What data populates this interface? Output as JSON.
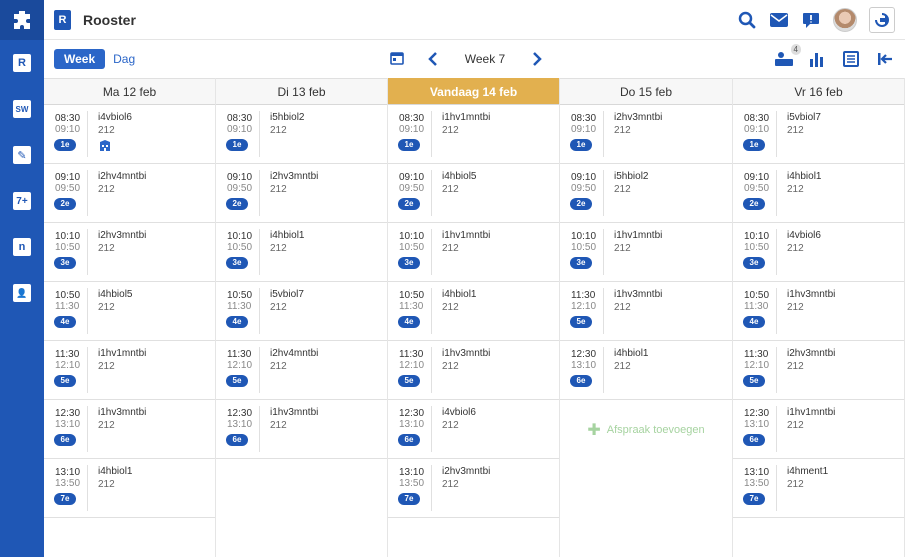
{
  "header": {
    "app_icon_letter": "R",
    "title": "Rooster"
  },
  "sidebar": {
    "items": [
      {
        "name": "rooster",
        "glyph": "R"
      },
      {
        "name": "sw",
        "glyph": "SW"
      },
      {
        "name": "huiswerk",
        "glyph": "✎"
      },
      {
        "name": "cijfers",
        "glyph": "7+"
      },
      {
        "name": "nieuws",
        "glyph": "n"
      },
      {
        "name": "leerlingen",
        "glyph": "👤"
      }
    ]
  },
  "toolbar": {
    "week_label": "Week",
    "day_label": "Dag",
    "current_week": "Week 7",
    "notifications_badge": "4"
  },
  "colors": {
    "brand": "#1f57b5",
    "today": "#e2b04f",
    "add": "#a6d3a0"
  },
  "days": [
    {
      "label": "Ma 12 feb",
      "today": false,
      "lessons": [
        {
          "start": "08:30",
          "end": "09:10",
          "hour": "1e",
          "group": "i4vbiol6",
          "room": "212",
          "icon": "building-icon"
        },
        {
          "start": "09:10",
          "end": "09:50",
          "hour": "2e",
          "group": "i2hv4mntbi",
          "room": "212"
        },
        {
          "start": "10:10",
          "end": "10:50",
          "hour": "3e",
          "group": "i2hv3mntbi",
          "room": "212"
        },
        {
          "start": "10:50",
          "end": "11:30",
          "hour": "4e",
          "group": "i4hbiol5",
          "room": "212"
        },
        {
          "start": "11:30",
          "end": "12:10",
          "hour": "5e",
          "group": "i1hv1mntbi",
          "room": "212"
        },
        {
          "start": "12:30",
          "end": "13:10",
          "hour": "6e",
          "group": "i1hv3mntbi",
          "room": "212"
        },
        {
          "start": "13:10",
          "end": "13:50",
          "hour": "7e",
          "group": "i4hbiol1",
          "room": "212"
        }
      ]
    },
    {
      "label": "Di 13 feb",
      "today": false,
      "lessons": [
        {
          "start": "08:30",
          "end": "09:10",
          "hour": "1e",
          "group": "i5hbiol2",
          "room": "212"
        },
        {
          "start": "09:10",
          "end": "09:50",
          "hour": "2e",
          "group": "i2hv3mntbi",
          "room": "212"
        },
        {
          "start": "10:10",
          "end": "10:50",
          "hour": "3e",
          "group": "i4hbiol1",
          "room": "212"
        },
        {
          "start": "10:50",
          "end": "11:30",
          "hour": "4e",
          "group": "i5vbiol7",
          "room": "212"
        },
        {
          "start": "11:30",
          "end": "12:10",
          "hour": "5e",
          "group": "i2hv4mntbi",
          "room": "212"
        },
        {
          "start": "12:30",
          "end": "13:10",
          "hour": "6e",
          "group": "i1hv3mntbi",
          "room": "212"
        }
      ]
    },
    {
      "label": "Vandaag 14 feb",
      "today": true,
      "lessons": [
        {
          "start": "08:30",
          "end": "09:10",
          "hour": "1e",
          "group": "i1hv1mntbi",
          "room": "212"
        },
        {
          "start": "09:10",
          "end": "09:50",
          "hour": "2e",
          "group": "i4hbiol5",
          "room": "212"
        },
        {
          "start": "10:10",
          "end": "10:50",
          "hour": "3e",
          "group": "i1hv1mntbi",
          "room": "212"
        },
        {
          "start": "10:50",
          "end": "11:30",
          "hour": "4e",
          "group": "i4hbiol1",
          "room": "212"
        },
        {
          "start": "11:30",
          "end": "12:10",
          "hour": "5e",
          "group": "i1hv3mntbi",
          "room": "212"
        },
        {
          "start": "12:30",
          "end": "13:10",
          "hour": "6e",
          "group": "i4vbiol6",
          "room": "212"
        },
        {
          "start": "13:10",
          "end": "13:50",
          "hour": "7e",
          "group": "i2hv3mntbi",
          "room": "212"
        }
      ]
    },
    {
      "label": "Do 15 feb",
      "today": false,
      "lessons": [
        {
          "start": "08:30",
          "end": "09:10",
          "hour": "1e",
          "group": "i2hv3mntbi",
          "room": "212"
        },
        {
          "start": "09:10",
          "end": "09:50",
          "hour": "2e",
          "group": "i5hbiol2",
          "room": "212"
        },
        {
          "start": "10:10",
          "end": "10:50",
          "hour": "3e",
          "group": "i1hv1mntbi",
          "room": "212"
        },
        {
          "start": "11:30",
          "end": "12:10",
          "hour": "5e",
          "group": "i1hv3mntbi",
          "room": "212"
        },
        {
          "start": "12:30",
          "end": "13:10",
          "hour": "6e",
          "group": "i4hbiol1",
          "room": "212"
        }
      ],
      "add_label": "Afspraak toevoegen"
    },
    {
      "label": "Vr 16 feb",
      "today": false,
      "lessons": [
        {
          "start": "08:30",
          "end": "09:10",
          "hour": "1e",
          "group": "i5vbiol7",
          "room": "212"
        },
        {
          "start": "09:10",
          "end": "09:50",
          "hour": "2e",
          "group": "i4hbiol1",
          "room": "212"
        },
        {
          "start": "10:10",
          "end": "10:50",
          "hour": "3e",
          "group": "i4vbiol6",
          "room": "212"
        },
        {
          "start": "10:50",
          "end": "11:30",
          "hour": "4e",
          "group": "i1hv3mntbi",
          "room": "212"
        },
        {
          "start": "11:30",
          "end": "12:10",
          "hour": "5e",
          "group": "i2hv3mntbi",
          "room": "212"
        },
        {
          "start": "12:30",
          "end": "13:10",
          "hour": "6e",
          "group": "i1hv1mntbi",
          "room": "212"
        },
        {
          "start": "13:10",
          "end": "13:50",
          "hour": "7e",
          "group": "i4hment1",
          "room": "212"
        }
      ]
    }
  ]
}
